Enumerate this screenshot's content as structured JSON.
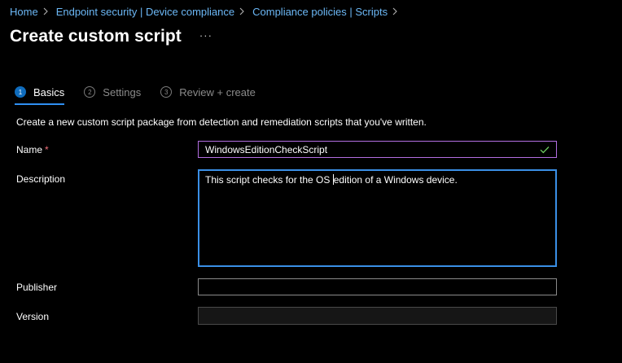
{
  "breadcrumb": {
    "items": [
      "Home",
      "Endpoint security | Device compliance",
      "Compliance policies | Scripts"
    ]
  },
  "page": {
    "title": "Create custom script",
    "more": "···"
  },
  "wizard": {
    "steps": [
      {
        "number": "1",
        "label": "Basics",
        "active": true
      },
      {
        "number": "2",
        "label": "Settings",
        "active": false
      },
      {
        "number": "3",
        "label": "Review + create",
        "active": false
      }
    ]
  },
  "form": {
    "intro": "Create a new custom script package from detection and remediation scripts that you've written.",
    "name": {
      "label": "Name",
      "required": "*",
      "value": "WindowsEditionCheckScript",
      "valid": true
    },
    "description": {
      "label": "Description",
      "value_before_caret": "This script checks for the OS ",
      "value_after_caret": "edition of a Windows device."
    },
    "publisher": {
      "label": "Publisher",
      "value": ""
    },
    "version": {
      "label": "Version",
      "value": "",
      "disabled": true
    }
  },
  "colors": {
    "background": "#000000",
    "link": "#6cb8f6",
    "accent": "#0f6cbd",
    "required": "#f1707b",
    "name_border": "#b36ee2",
    "focus_border": "#3a8fe6",
    "valid_check": "#6ccb5f"
  },
  "icons": {
    "breadcrumb_separator": "chevron-right-icon",
    "more": "more-icon",
    "valid": "checkmark-icon"
  }
}
